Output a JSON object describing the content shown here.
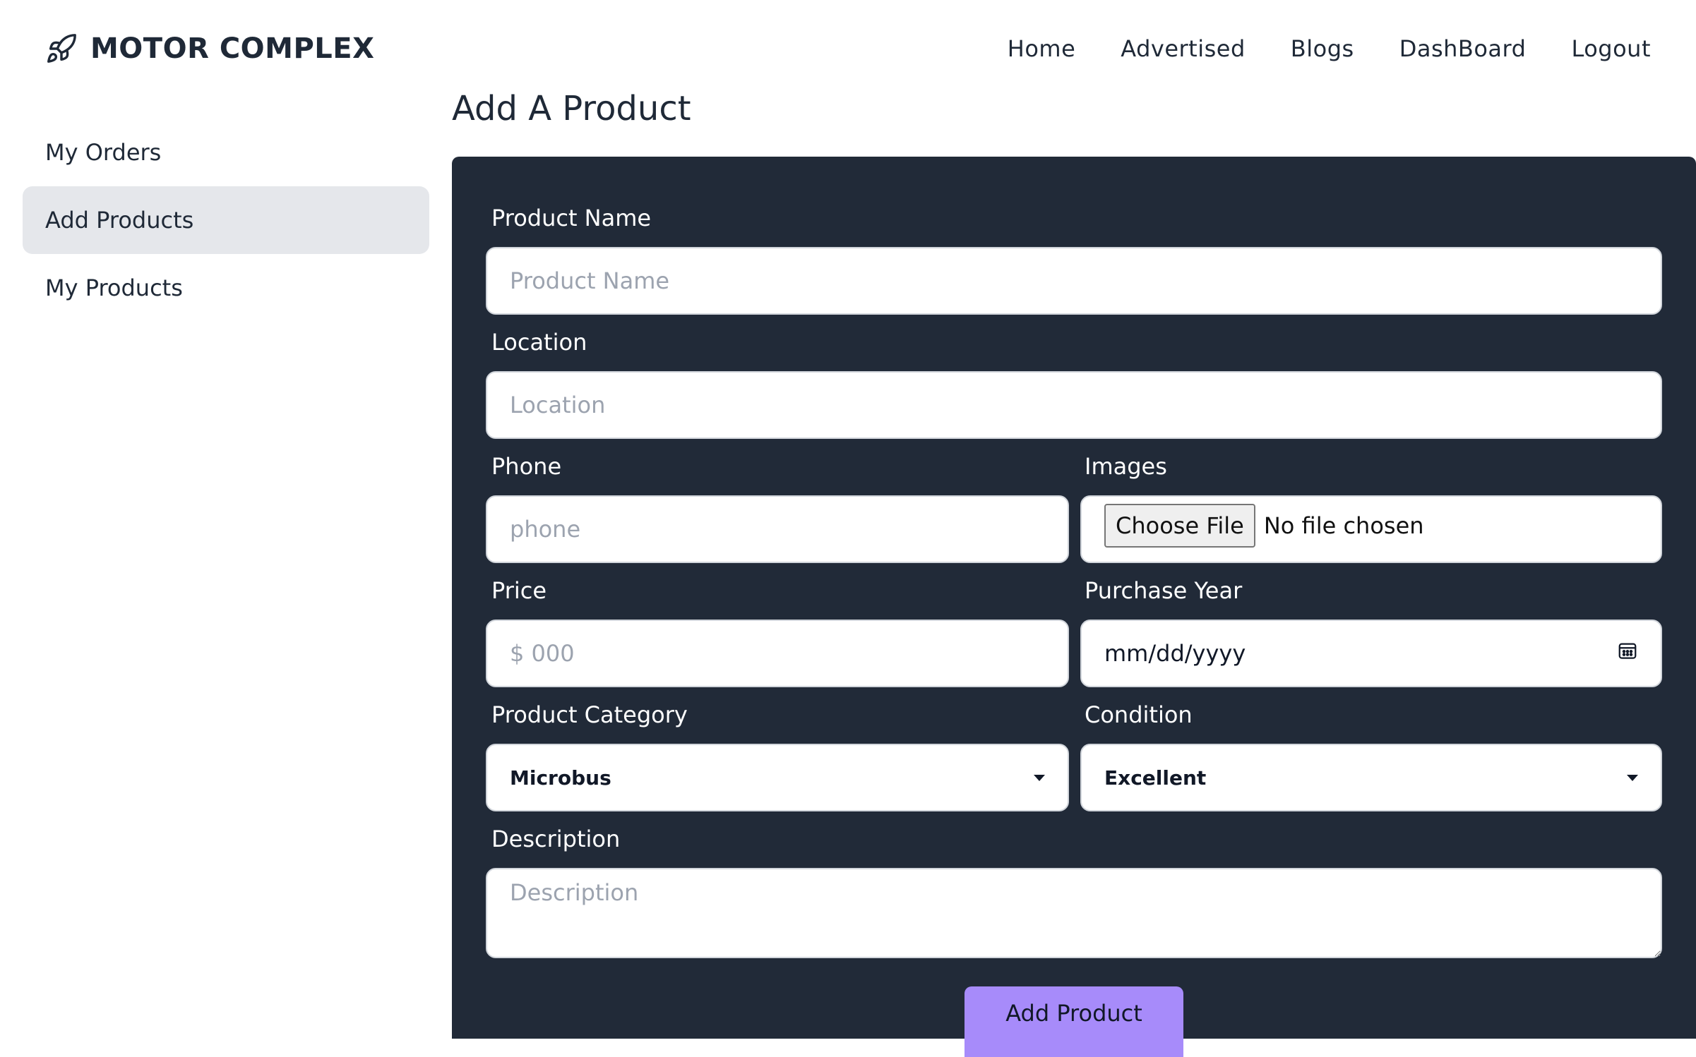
{
  "brand": {
    "name": "MOTOR COMPLEX",
    "icon": "rocket-icon"
  },
  "nav": {
    "items": [
      "Home",
      "Advertised",
      "Blogs",
      "DashBoard",
      "Logout"
    ]
  },
  "sidebar": {
    "items": [
      {
        "label": "My Orders",
        "active": false
      },
      {
        "label": "Add Products",
        "active": true
      },
      {
        "label": "My Products",
        "active": false
      }
    ]
  },
  "page": {
    "title": "Add A Product"
  },
  "form": {
    "product_name": {
      "label": "Product Name",
      "placeholder": "Product Name"
    },
    "location": {
      "label": "Location",
      "placeholder": "Location"
    },
    "phone": {
      "label": "Phone",
      "placeholder": "phone"
    },
    "images": {
      "label": "Images",
      "button": "Choose File",
      "status": "No file chosen"
    },
    "price": {
      "label": "Price",
      "placeholder": "$ 000"
    },
    "purchase_year": {
      "label": "Purchase Year",
      "placeholder": "mm/dd/yyyy",
      "icon": "calendar-icon"
    },
    "category": {
      "label": "Product Category",
      "selected": "Microbus"
    },
    "condition": {
      "label": "Condition",
      "selected": "Excellent"
    },
    "description": {
      "label": "Description",
      "placeholder": "Description"
    },
    "submit": "Add Product"
  },
  "colors": {
    "panel": "#212a38",
    "accent": "#a78bfa",
    "active_item": "#e5e7eb"
  }
}
